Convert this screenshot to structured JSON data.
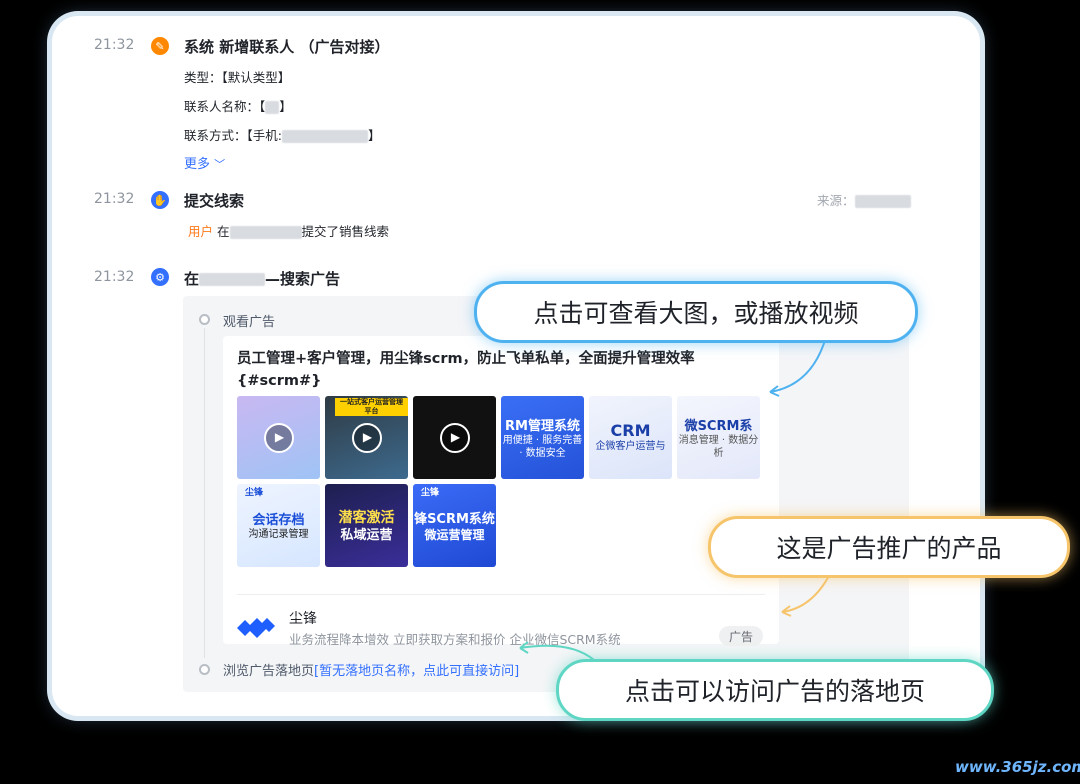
{
  "events": [
    {
      "time": "21:32",
      "icon": "pencil-icon",
      "icon_color": "#ff8800",
      "title": "系统   新增联系人 （广告对接）",
      "details": {
        "type_label": "类型：",
        "type_value": "【默认类型】",
        "name_label": "联系人名称：",
        "name_open": "【",
        "name_close": "】",
        "contact_label": "联系方式：",
        "contact_open": "【手机:",
        "contact_close": "】"
      },
      "more_label": "更多"
    },
    {
      "time": "21:32",
      "icon": "hand-icon",
      "icon_color": "#3370ff",
      "title": "提交线索",
      "source_label": "来源：",
      "user_label": "用户",
      "text_before": "在",
      "text_after": "提交了销售线索"
    },
    {
      "time": "21:32",
      "icon": "gear-icon",
      "icon_color": "#3370ff",
      "title_prefix": "在",
      "title_suffix": "—搜索广告"
    }
  ],
  "ad": {
    "step_view": "观看广告",
    "text_line1": "员工管理+客户管理，用尘锋scrm，防止飞单私单，全面提升管理效率",
    "text_line2": "{#scrm#}",
    "thumbs": [
      {
        "kind": "video",
        "bg": "#b7c6f0"
      },
      {
        "kind": "video",
        "bg": "#4a5a6a",
        "caption": "一站式客户运营管理平台"
      },
      {
        "kind": "video",
        "bg": "#111111"
      },
      {
        "kind": "image",
        "bg": "#2b63f0",
        "text": "RM管理系统",
        "sub": "用便捷 · 服务完善 · 数据安全"
      },
      {
        "kind": "image",
        "bg": "#e9eefb",
        "text": "CRM",
        "sub": "企微客户运营与"
      },
      {
        "kind": "image",
        "bg": "#eef1fb",
        "text": "微SCRM系",
        "sub": "消息管理 · 数据分析"
      },
      {
        "kind": "image",
        "bg": "#e8f0fe",
        "text": "会话存档",
        "sub": "沟通记录管理",
        "brand": "尘锋"
      },
      {
        "kind": "image",
        "bg": "#2a2f8a",
        "text": "潜客激活",
        "sub": "私域运营"
      },
      {
        "kind": "image",
        "bg": "#2f5ef0",
        "text": "锋SCRM系统",
        "sub": "微运营管理",
        "brand": "尘锋"
      }
    ],
    "brand_name": "尘锋",
    "brand_desc": "业务流程降本增效 立即获取方案和报价 企业微信SCRM系统",
    "tag": "广告",
    "step_landing": "浏览广告落地页",
    "landing_link": "[暂无落地页名称，点此可直接访问]"
  },
  "callouts": {
    "view_image": "点击可查看大图，或播放视频",
    "product": "这是广告推广的产品",
    "landing": "点击可以访问广告的落地页"
  },
  "watermark": "www.365jz.com",
  "colors": {
    "accent_blue": "#3370ff",
    "user_orange": "#ff7a1a",
    "callout_blue": "#4fb2f0",
    "callout_orange": "#f6c46a",
    "callout_teal": "#5fd6c4"
  }
}
